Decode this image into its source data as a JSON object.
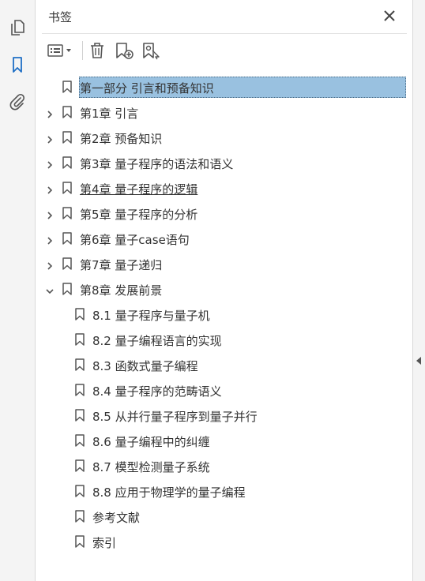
{
  "panel": {
    "title": "书签",
    "close_icon": "close-icon"
  },
  "rail": {
    "icons": [
      "pages-icon",
      "bookmark-icon",
      "attachment-icon"
    ],
    "accent": "#1f6fc5"
  },
  "toolbar": {
    "icons": [
      "options-menu-icon",
      "delete-icon",
      "new-bookmark-icon",
      "new-bookmark-from-structure-icon"
    ]
  },
  "bookmarks": [
    {
      "label": "第一部分  引言和预备知识",
      "selected": true
    },
    {
      "label": "第1章  引言",
      "expand": "collapsed"
    },
    {
      "label": "第2章  预备知识",
      "expand": "collapsed"
    },
    {
      "label": "第3章  量子程序的语法和语义",
      "expand": "collapsed"
    },
    {
      "label": "第4章  量子程序的逻辑",
      "expand": "collapsed"
    },
    {
      "label": "第5章  量子程序的分析",
      "expand": "collapsed"
    },
    {
      "label": "第6章  量子case语句",
      "expand": "collapsed"
    },
    {
      "label": "第7章  量子递归",
      "expand": "collapsed"
    },
    {
      "label": "第8章  发展前景",
      "expand": "expanded"
    },
    {
      "label": "8.1  量子程序与量子机"
    },
    {
      "label": "8.2  量子编程语言的实现"
    },
    {
      "label": "8.3  函数式量子编程"
    },
    {
      "label": "8.4  量子程序的范畴语义"
    },
    {
      "label": "8.5  从并行量子程序到量子并行"
    },
    {
      "label": "8.6  量子编程中的纠缠"
    },
    {
      "label": "8.7  模型检测量子系统"
    },
    {
      "label": "8.8  应用于物理学的量子编程"
    },
    {
      "label": "参考文献"
    },
    {
      "label": "索引"
    }
  ],
  "colors": {
    "selection": "#99c1e0",
    "text": "#333333"
  }
}
